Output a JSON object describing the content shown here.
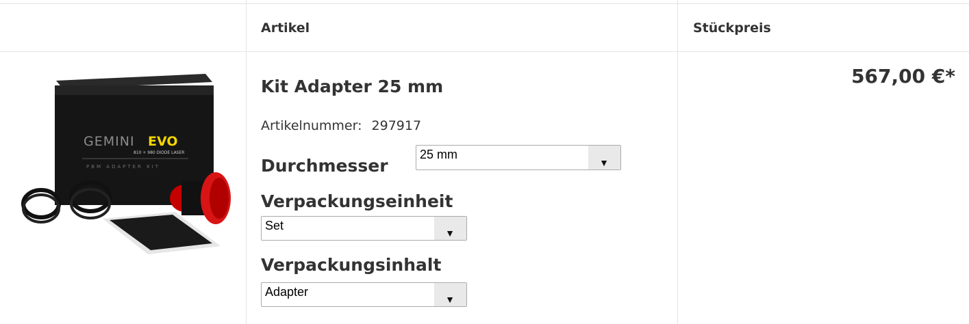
{
  "header": {
    "col_article": "Artikel",
    "col_price": "Stückpreis"
  },
  "product": {
    "title": "Kit Adapter 25 mm",
    "article_number_label": "Artikelnummer:",
    "article_number": "297917",
    "price": "567,00 €*",
    "image_alt": "Gemini EVO PBM Adapter Kit",
    "box_brand": "GEMINI",
    "box_brand_accent": "EVO",
    "box_subtitle": "810 + 980 DIODE LASER",
    "box_label": "PBM ADAPTER KIT",
    "options": [
      {
        "label": "Durchmesser",
        "value": "25 mm"
      },
      {
        "label": "Verpackungseinheit",
        "value": "Set"
      },
      {
        "label": "Verpackungsinhalt",
        "value": "Adapter"
      }
    ]
  },
  "colors": {
    "accent": "#f2d500",
    "border": "#e4e4e4",
    "text": "#333333"
  }
}
